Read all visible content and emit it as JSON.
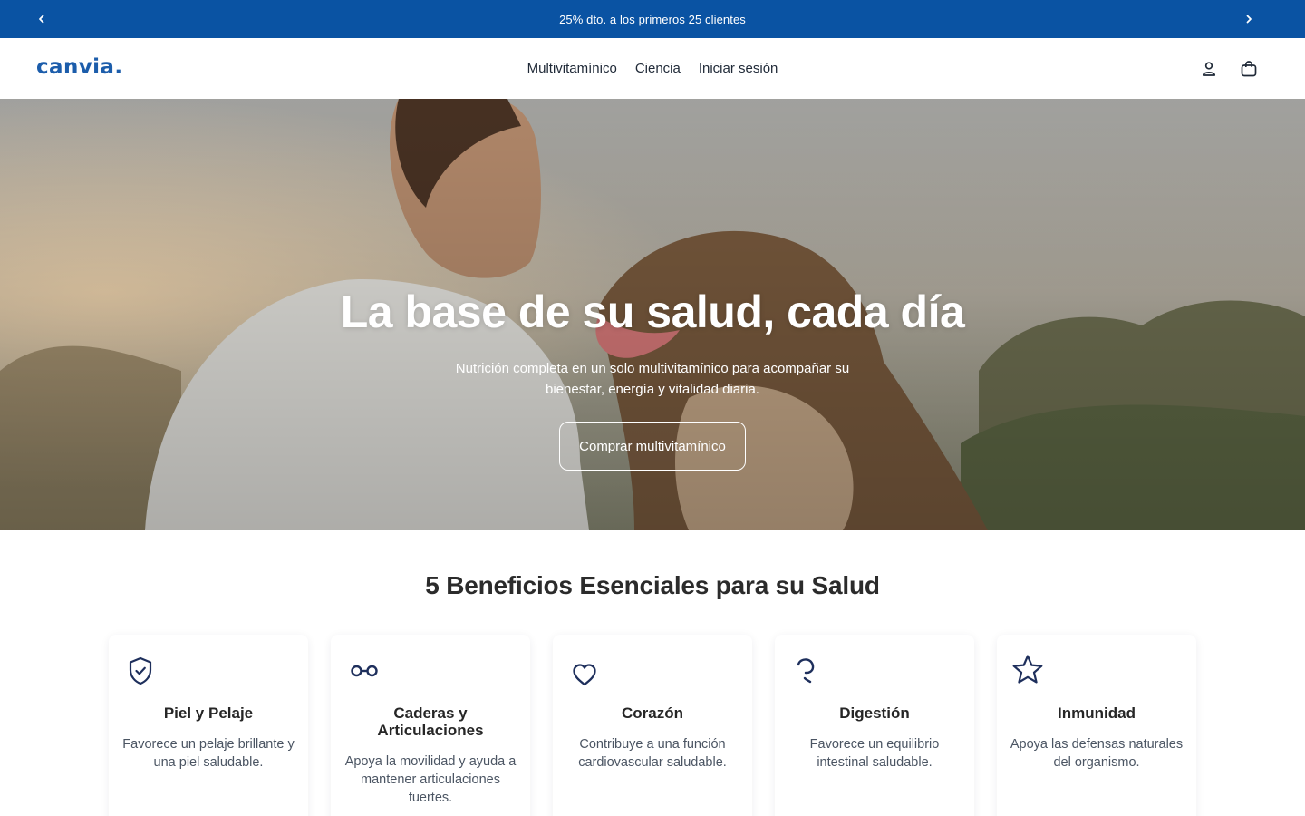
{
  "announcement": {
    "text": "25% dto. a los primeros 25 clientes",
    "prev_icon": "chevron-left-icon",
    "next_icon": "chevron-right-icon",
    "bg_color": "#0a53a3"
  },
  "header": {
    "logo": "canvia.",
    "nav": [
      "Multivitamínico",
      "Ciencia",
      "Iniciar sesión"
    ],
    "icons": [
      "account-icon",
      "cart-icon"
    ],
    "brand_color": "#1c5dab"
  },
  "hero": {
    "title": "La base de su salud, cada día",
    "subtitle": "Nutrición completa en un solo multivitamínico para acompañar su bienestar, energía y vitalidad diaria.",
    "cta": "Comprar multivitamínico"
  },
  "benefits": {
    "title": "5 Beneficios Esenciales para su Salud",
    "icon_color": "#1e2f5c",
    "items": [
      {
        "icon": "shield-check-icon",
        "title": "Piel y Pelaje",
        "desc": "Favorece un pelaje brillante y una piel saludable."
      },
      {
        "icon": "joint-link-icon",
        "title": "Caderas y Articulaciones",
        "desc": "Apoya la movilidad y ayuda a mantener articulaciones fuertes."
      },
      {
        "icon": "heart-icon",
        "title": "Corazón",
        "desc": "Contribuye a una función cardiovascular saludable."
      },
      {
        "icon": "digestion-icon",
        "title": "Digestión",
        "desc": "Favorece un equilibrio intestinal saludable."
      },
      {
        "icon": "star-icon",
        "title": "Inmunidad",
        "desc": "Apoya las defensas naturales del organismo."
      }
    ]
  }
}
